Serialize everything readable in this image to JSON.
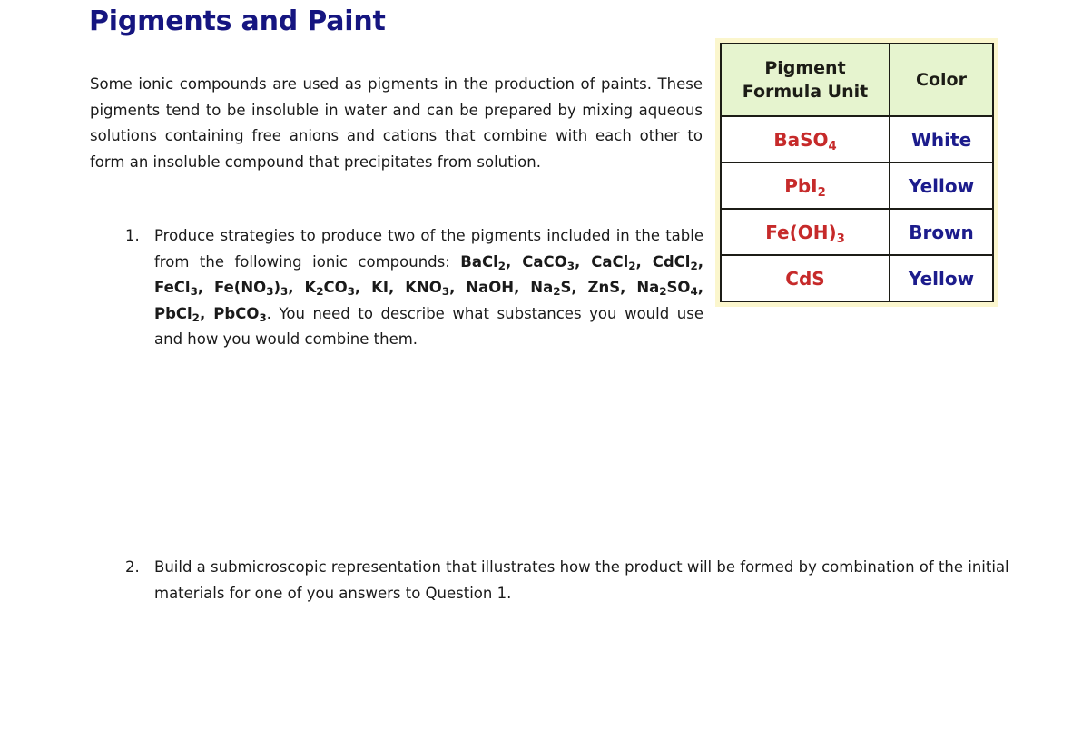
{
  "page": {
    "title": "Pigments and Paint",
    "title_color": "#151580",
    "background": "#ffffff"
  },
  "intro": {
    "paragraph": "Some ionic compounds are used as pigments in the production of paints. These pigments tend to be insoluble in water and can be prepared by mixing aqueous solutions containing free anions and cations that combine with each other to form an insoluble compound that precipitates from solution."
  },
  "questions": [
    {
      "marker": "1.",
      "text_before": "Produce strategies to produce two of the pigments included in the table from the following ionic compounds: ",
      "formulas_html": "BaCl<sub>2</sub>, CaCO<sub>3</sub>, CaCl<sub>2</sub>, CdCl<sub>2</sub>, FeCl<sub>3</sub>, Fe(NO<sub>3</sub>)<sub>3</sub>, K<sub>2</sub>CO<sub>3</sub>, KI, KNO<sub>3</sub>, NaOH, Na<sub>2</sub>S, ZnS, Na<sub>2</sub>SO<sub>4</sub>, PbCl<sub>2</sub>, PbCO<sub>3</sub>",
      "formulas_plain": "BaCl2, CaCO3, CaCl2, CdCl2, FeCl3, Fe(NO3)3, K2CO3, KI, KNO3, NaOH, Na2S, ZnS, Na2SO4, PbCl2, PbCO3",
      "text_after": ". You need to describe what substances you would use and how you would combine them."
    },
    {
      "marker": "2.",
      "text_before": "Build a submicroscopic representation that illustrates how the product will be formed by combination of the initial materials for one of you answers to Question 1.",
      "formulas_html": "",
      "formulas_plain": "",
      "text_after": ""
    }
  ],
  "pigment_table": {
    "header_background": "#e6f4cf",
    "frame_background": "#fbf6cd",
    "border_color": "#1c1c16",
    "formula_color": "#c62a2a",
    "color_text_color": "#1c1c8c",
    "headers": {
      "formula_line1": "Pigment",
      "formula_line2": "Formula Unit",
      "color": "Color"
    },
    "rows": [
      {
        "formula_html": "BaSO<sub>4</sub>",
        "formula_plain": "BaSO4",
        "color": "White"
      },
      {
        "formula_html": "PbI<sub>2</sub>",
        "formula_plain": "PbI2",
        "color": "Yellow"
      },
      {
        "formula_html": "Fe(OH)<sub>3</sub>",
        "formula_plain": "Fe(OH)3",
        "color": "Brown"
      },
      {
        "formula_html": "CdS",
        "formula_plain": "CdS",
        "color": "Yellow"
      }
    ]
  }
}
